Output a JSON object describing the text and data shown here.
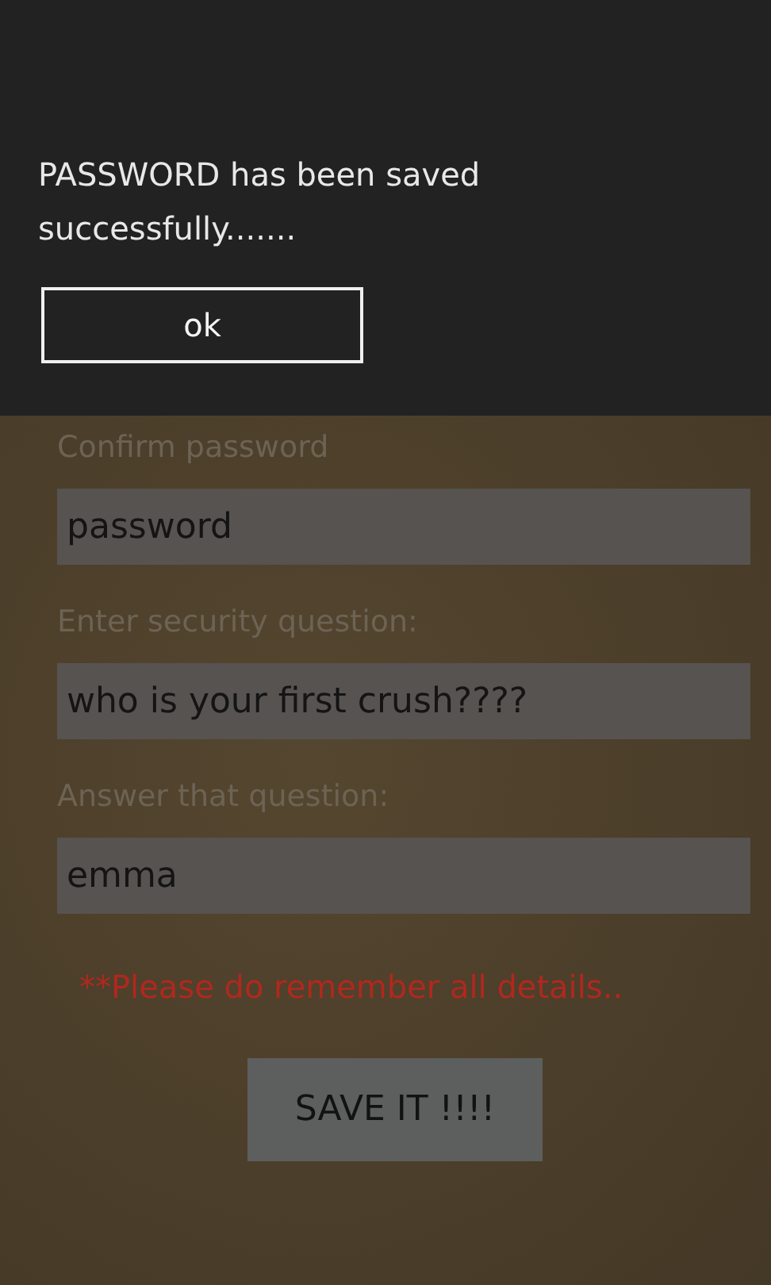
{
  "dialog": {
    "message": "PASSWORD has been saved successfully.......",
    "button": "ok"
  },
  "form": {
    "fields": [
      {
        "label": "Confirm password",
        "value": "password"
      },
      {
        "label": "Enter security question:",
        "value": "who is your first crush????"
      },
      {
        "label": "Answer that question:",
        "value": "emma"
      }
    ],
    "note": "**Please do remember all details..",
    "button": "SAVE IT !!!!"
  }
}
